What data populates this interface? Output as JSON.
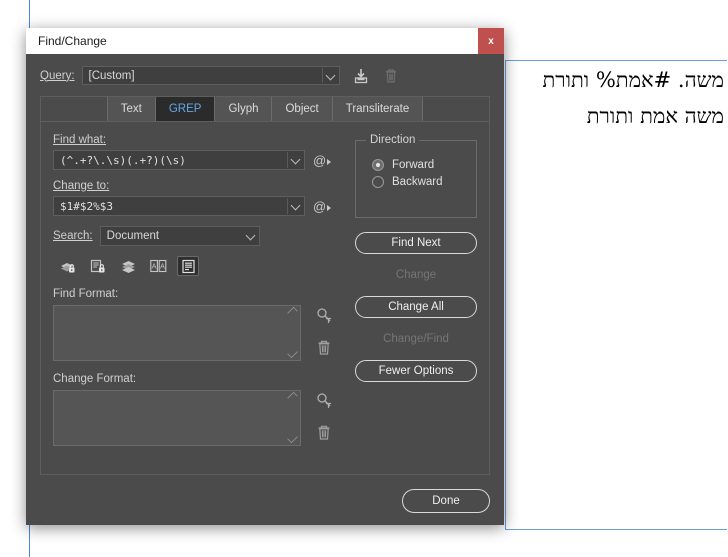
{
  "document": {
    "hebrew_line_1": "משה. #אמת% ותורת",
    "hebrew_line_2": "משה אמת ותורת"
  },
  "dialog": {
    "title": "Find/Change",
    "close_label": "x"
  },
  "query": {
    "label": "Query:",
    "value": "[Custom]",
    "save_icon": "save-query-icon",
    "delete_icon": "delete-query-icon"
  },
  "tabs": [
    {
      "label": "Text",
      "active": false
    },
    {
      "label": "GREP",
      "active": true
    },
    {
      "label": "Glyph",
      "active": false
    },
    {
      "label": "Object",
      "active": false
    },
    {
      "label": "Transliterate",
      "active": false
    }
  ],
  "find": {
    "label": "Find what:",
    "value": "(^.+?\\.\\s)(.+?)(\\s)",
    "special_chars_icon": "at-symbol-icon"
  },
  "change": {
    "label": "Change to:",
    "value": "$1#$2%$3",
    "special_chars_icon": "at-symbol-icon"
  },
  "search": {
    "label": "Search:",
    "value": "Document"
  },
  "scope_icons": [
    {
      "name": "include-locked-layers-icon",
      "active": false
    },
    {
      "name": "include-locked-stories-icon",
      "active": false
    },
    {
      "name": "include-hidden-layers-icon",
      "active": false
    },
    {
      "name": "include-master-pages-icon",
      "active": false
    },
    {
      "name": "include-footnotes-icon",
      "active": true
    }
  ],
  "find_format": {
    "label": "Find Format:",
    "value": "",
    "specify_icon": "specify-attributes-icon",
    "clear_icon": "clear-attributes-icon"
  },
  "change_format": {
    "label": "Change Format:",
    "value": "",
    "specify_icon": "specify-attributes-icon",
    "clear_icon": "clear-attributes-icon"
  },
  "direction": {
    "legend": "Direction",
    "options": [
      {
        "label": "Forward",
        "selected": true
      },
      {
        "label": "Backward",
        "selected": false
      }
    ]
  },
  "buttons": {
    "find_next": {
      "label": "Find Next",
      "enabled": true
    },
    "change": {
      "label": "Change",
      "enabled": false
    },
    "change_all": {
      "label": "Change All",
      "enabled": true
    },
    "change_find": {
      "label": "Change/Find",
      "enabled": false
    },
    "fewer_options": {
      "label": "Fewer Options",
      "enabled": true
    },
    "done": {
      "label": "Done",
      "enabled": true
    }
  },
  "colors": {
    "dialog_bg": "#4b4b4b",
    "titlebar_bg": "#ffffff",
    "close_bg": "#c0504d",
    "tab_active_bg": "#2b2b2b",
    "tab_active_text": "#64a8e8",
    "field_bg": "#3f3f3f",
    "frame_border": "#6a9fe0"
  }
}
